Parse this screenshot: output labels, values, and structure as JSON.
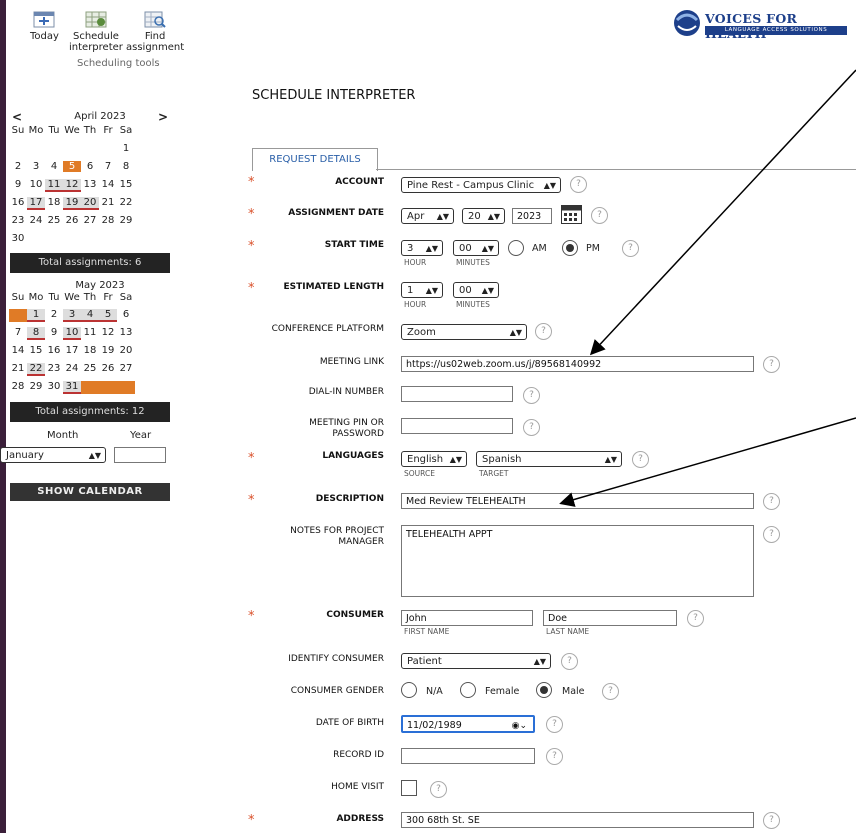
{
  "toolbar": {
    "today": "Today",
    "schedule_line1": "Schedule",
    "schedule_line2": "interpreter",
    "find_line1": "Find",
    "find_line2": "assignment",
    "caption": "Scheduling tools"
  },
  "logo": {
    "title": "VOICES FOR HEALTH",
    "subtitle": "LANGUAGE ACCESS SOLUTIONS"
  },
  "calendar": {
    "prev": "<",
    "next": ">",
    "april": {
      "title": "April 2023",
      "weekdays": [
        "Su",
        "Mo",
        "Tu",
        "We",
        "Th",
        "Fr",
        "Sa"
      ],
      "rows": [
        [
          "",
          "",
          "",
          "",
          "",
          "",
          "1"
        ],
        [
          "2",
          "3",
          "4",
          "5",
          "6",
          "7",
          "8"
        ],
        [
          "9",
          "10",
          "11",
          "12",
          "13",
          "14",
          "15"
        ],
        [
          "16",
          "17",
          "18",
          "19",
          "20",
          "21",
          "22"
        ],
        [
          "23",
          "24",
          "25",
          "26",
          "27",
          "28",
          "29"
        ],
        [
          "30",
          "",
          "",
          "",
          "",
          "",
          ""
        ]
      ],
      "total": "Total assignments: 6"
    },
    "may": {
      "title": "May 2023",
      "weekdays": [
        "Su",
        "Mo",
        "Tu",
        "We",
        "Th",
        "Fr",
        "Sa"
      ],
      "rows": [
        [
          "",
          "1",
          "2",
          "3",
          "4",
          "5",
          "6"
        ],
        [
          "7",
          "8",
          "9",
          "10",
          "11",
          "12",
          "13"
        ],
        [
          "14",
          "15",
          "16",
          "17",
          "18",
          "19",
          "20"
        ],
        [
          "21",
          "22",
          "23",
          "24",
          "25",
          "26",
          "27"
        ],
        [
          "28",
          "29",
          "30",
          "31",
          "",
          "",
          ""
        ]
      ],
      "total": "Total assignments: 12"
    },
    "month_label": "Month",
    "year_label": "Year",
    "month_value": "January",
    "year_value": "",
    "show_button": "SHOW CALENDAR"
  },
  "page_title": "SCHEDULE INTERPRETER",
  "tab": "REQUEST DETAILS",
  "help": "?",
  "form": {
    "account_label": "ACCOUNT",
    "account_value": "Pine Rest - Campus Clinic",
    "date_label": "ASSIGNMENT DATE",
    "date_month": "Apr",
    "date_day": "20",
    "date_year": "2023",
    "start_label": "START TIME",
    "start_hour": "3",
    "start_min": "00",
    "hour_sub": "HOUR",
    "minutes_sub": "MINUTES",
    "am": "AM",
    "pm": "PM",
    "length_label": "ESTIMATED LENGTH",
    "length_hour": "1",
    "length_min": "00",
    "platform_label": "CONFERENCE PLATFORM",
    "platform_value": "Zoom",
    "link_label": "MEETING LINK",
    "link_value": "https://us02web.zoom.us/j/89568140992",
    "dial_label": "DIAL-IN NUMBER",
    "dial_value": "",
    "pin_label_1": "MEETING PIN OR",
    "pin_label_2": "PASSWORD",
    "pin_value": "",
    "lang_label": "LANGUAGES",
    "lang_source": "English",
    "lang_target": "Spanish",
    "source_sub": "SOURCE",
    "target_sub": "TARGET",
    "desc_label": "DESCRIPTION",
    "desc_value": "Med Review TELEHEALTH",
    "notes_label_1": "NOTES FOR PROJECT",
    "notes_label_2": "MANAGER",
    "notes_value": "TELEHEALTH APPT",
    "consumer_label": "CONSUMER",
    "first_name": "John",
    "last_name": "Doe",
    "first_sub": "FIRST NAME",
    "last_sub": "LAST NAME",
    "identify_label": "IDENTIFY CONSUMER",
    "identify_value": "Patient",
    "gender_label": "CONSUMER GENDER",
    "gender_na": "N/A",
    "gender_female": "Female",
    "gender_male": "Male",
    "dob_label": "DATE OF BIRTH",
    "dob_value": "11/02/1989",
    "record_label": "RECORD ID",
    "record_value": "",
    "home_label": "HOME VISIT",
    "address_label": "ADDRESS",
    "address_value": "300 68th St. SE"
  }
}
